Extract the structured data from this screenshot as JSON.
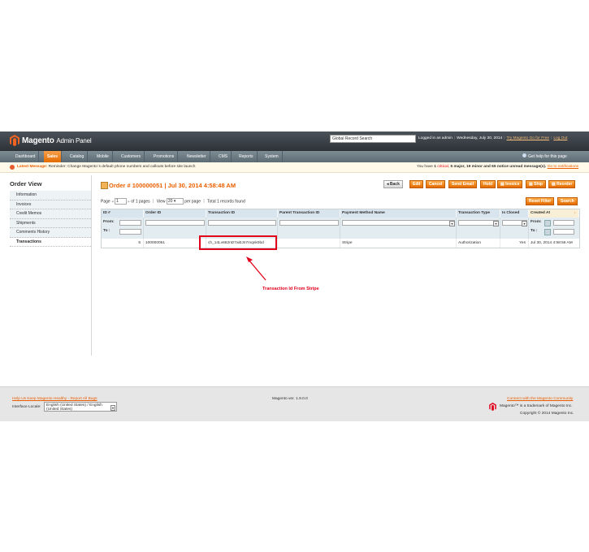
{
  "colors": {
    "accent": "#eb5e00",
    "header_bg": "#3a4047",
    "nav_bg": "#6b7a83",
    "annotation": "#e2001a"
  },
  "header": {
    "logo_text": "Magento",
    "logo_sub": "Admin Panel",
    "search_value": "Global Record Search",
    "logged_in": "Logged in as admin",
    "date": "Wednesday, July 30, 2014",
    "try_link": "Try Magento Go for Free",
    "logout": "Log Out"
  },
  "nav": {
    "items": [
      "Dashboard",
      "Sales",
      "Catalog",
      "Mobile",
      "Customers",
      "Promotions",
      "Newsletter",
      "CMS",
      "Reports",
      "System"
    ],
    "help": "Get help for this page"
  },
  "message": {
    "label": "Latest Message:",
    "text": "Reminder: Change Magento`s default phone numbers and callouts before site launch",
    "right_prefix": "You have",
    "critical_count": "1",
    "critical": "critical",
    "major": "5 major,",
    "minor": "19 minor and",
    "notice": "65 notice unread message(s).",
    "link": "Go to notifications"
  },
  "sidebar": {
    "title": "Order View",
    "tabs": [
      "Information",
      "Invoices",
      "Credit Memos",
      "Shipments",
      "Comments History",
      "Transactions"
    ]
  },
  "content": {
    "title": "Order # 100000051 | Jul 30, 2014 4:58:48 AM",
    "buttons": {
      "back": "Back",
      "edit": "Edit",
      "cancel": "Cancel",
      "send_email": "Send Email",
      "hold": "Hold",
      "invoice": "Invoice",
      "ship": "Ship",
      "reorder": "Reorder"
    }
  },
  "pager": {
    "page_label": "Page",
    "page_value": "1",
    "of_pages": "of 1 pages",
    "view_label": "View",
    "view_value": "20",
    "per_page": "per page",
    "total": "Total 1 records found",
    "reset": "Reset Filter",
    "search": "Search"
  },
  "grid": {
    "headers": [
      "ID #",
      "Order ID",
      "Transaction ID",
      "Parent Transaction ID",
      "Payment Method Name",
      "Transaction Type",
      "Is Closed",
      "Created At"
    ],
    "from_label": "From:",
    "to_label": "To :",
    "row": {
      "id": "5",
      "order_id": "100000051",
      "transaction_id": "ch_14Lv662nD7ai0Jn7mqnk0bd",
      "parent_id": "",
      "payment": "Stripe",
      "type": "Authorization",
      "closed": "Yes",
      "created": "Jul 30, 2014 4:58:56 AM"
    }
  },
  "annotation": {
    "label": "Transaction Id From Stripe"
  },
  "footer": {
    "bug_link": "Help Us Keep Magento Healthy - Report All Bugs",
    "locale_label": "Interface Locale:",
    "locale_value": "English (United States) / English (United States)",
    "version": "Magento ver. 1.9.0.0",
    "community": "Connect with the Magento Community",
    "trademark": "Magento™ is a trademark of Magento Inc.",
    "copyright": "Copyright © 2014 Magento Inc."
  }
}
